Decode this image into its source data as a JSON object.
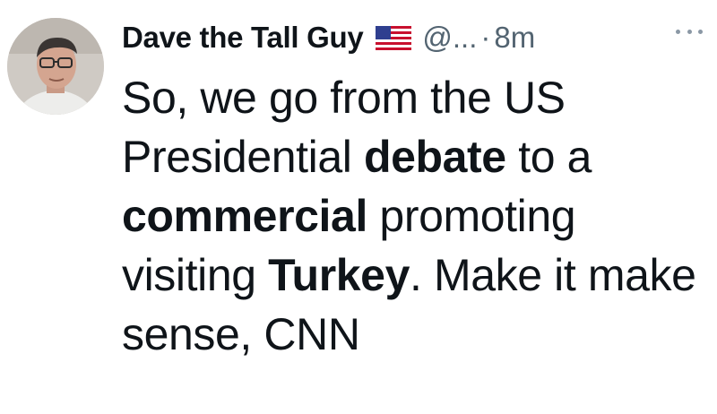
{
  "tweet": {
    "author": {
      "display_name": "Dave the Tall Guy",
      "flag_icon": "us-flag-icon",
      "handle": "@...",
      "separator": "·",
      "time": "8m",
      "avatar_icon": "user-avatar"
    },
    "more_icon": "more-horizontal-icon",
    "text": {
      "p1": "So, we go from the US Presidential ",
      "b1": "debate",
      "p2": " to a ",
      "b2": "commercial",
      "p3": " promoting visiting ",
      "b3": "Turkey",
      "p4": ". Make it make sense, CNN"
    }
  }
}
